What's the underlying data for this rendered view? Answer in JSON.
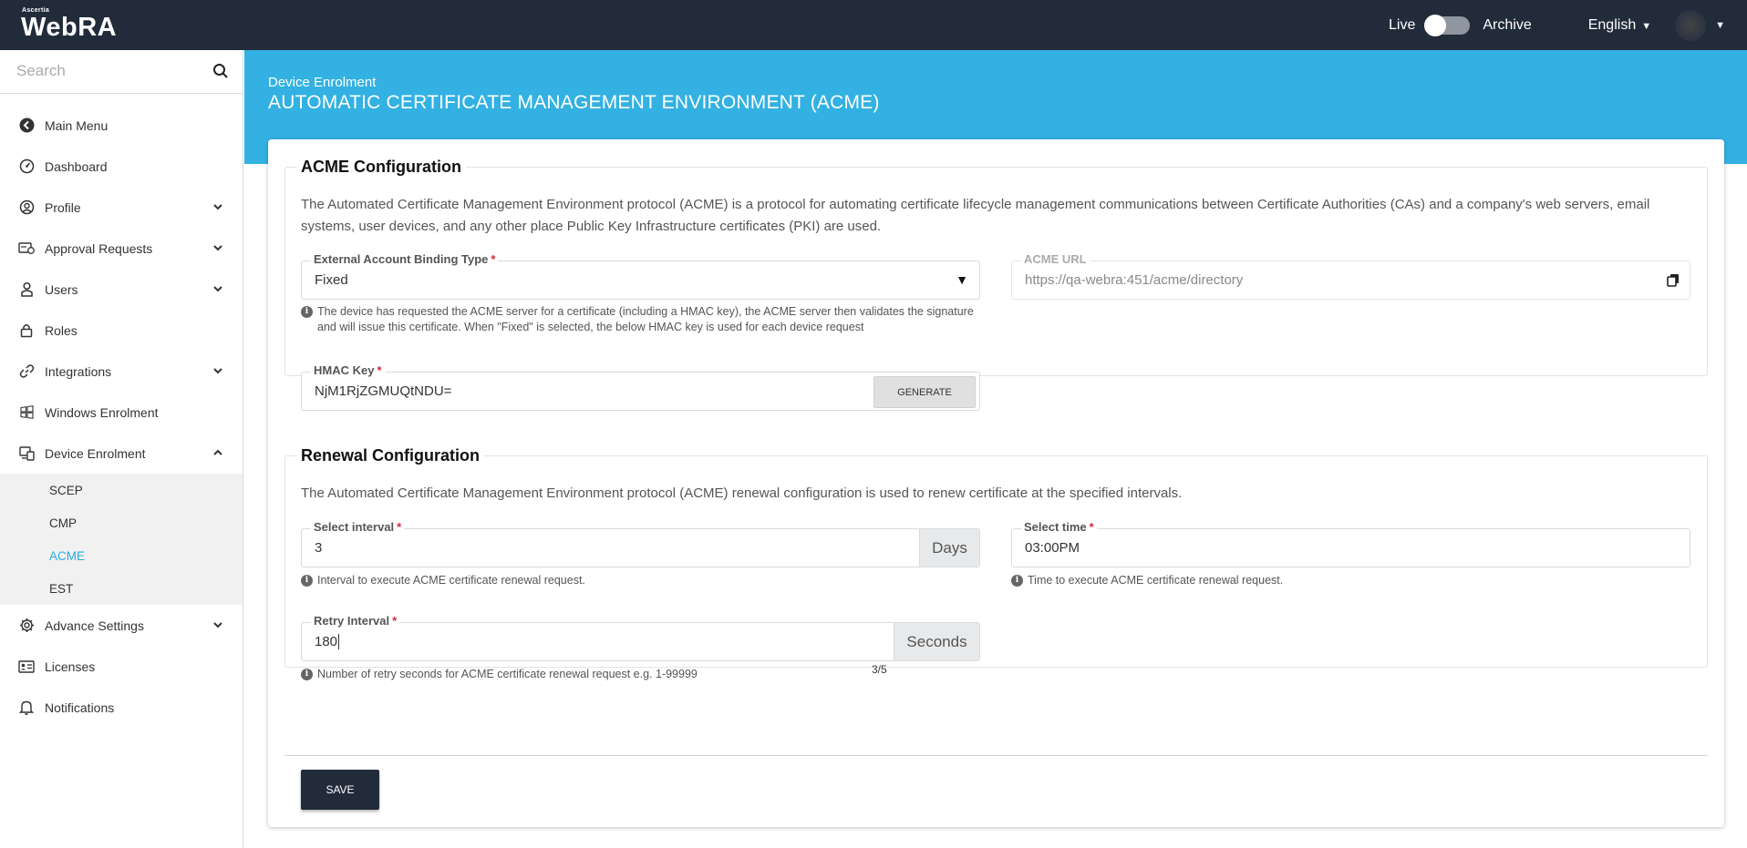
{
  "header": {
    "brand_small": "Ascertia",
    "brand_name": "WebRA",
    "live_label": "Live",
    "archive_label": "Archive",
    "language": "English"
  },
  "sidebar": {
    "search_placeholder": "Search",
    "items": [
      {
        "label": "Main Menu",
        "icon": "back-arrow-icon"
      },
      {
        "label": "Dashboard",
        "icon": "gauge-icon"
      },
      {
        "label": "Profile",
        "icon": "user-circle-icon"
      },
      {
        "label": "Approval Requests",
        "icon": "approval-card-icon"
      },
      {
        "label": "Users",
        "icon": "user-badge-icon"
      },
      {
        "label": "Roles",
        "icon": "lock-icon"
      },
      {
        "label": "Integrations",
        "icon": "link-icon"
      },
      {
        "label": "Windows Enrolment",
        "icon": "windows-icon"
      },
      {
        "label": "Device Enrolment",
        "icon": "device-icon"
      },
      {
        "label": "Advance Settings",
        "icon": "gear-icon"
      },
      {
        "label": "Licenses",
        "icon": "id-card-icon"
      },
      {
        "label": "Notifications",
        "icon": "bell-icon"
      }
    ],
    "sub_items": [
      "SCEP",
      "CMP",
      "ACME",
      "EST"
    ],
    "active_sub": "ACME"
  },
  "page": {
    "breadcrumb": "Device Enrolment",
    "title": "AUTOMATIC CERTIFICATE MANAGEMENT ENVIRONMENT (ACME)"
  },
  "acme": {
    "legend": "ACME Configuration",
    "description": "The Automated Certificate Management Environment protocol (ACME) is a protocol for automating certificate lifecycle management communications between Certificate Authorities (CAs) and a company's web servers, email systems, user devices, and any other place Public Key Infrastructure certificates (PKI) are used.",
    "binding_label": "External Account Binding Type",
    "binding_value": "Fixed",
    "binding_hint": "The device has requested the ACME server for a certificate (including a HMAC key), the ACME server then validates the signature and will issue this certificate. When \"Fixed\" is selected, the below HMAC key is used for each device request",
    "url_label": "ACME URL",
    "url_value": "https://qa-webra:451/acme/directory",
    "hmac_label": "HMAC Key",
    "hmac_value": "NjM1RjZGMUQtNDU=",
    "generate_label": "GENERATE"
  },
  "renewal": {
    "legend": "Renewal Configuration",
    "description": "The Automated Certificate Management Environment protocol (ACME) renewal configuration is used to renew certificate at the specified intervals.",
    "interval_label": "Select interval",
    "interval_value": "3",
    "interval_unit": "Days",
    "interval_hint": "Interval to execute ACME certificate renewal request.",
    "time_label": "Select time",
    "time_value": "03:00PM",
    "time_hint": "Time to execute ACME certificate renewal request.",
    "retry_label": "Retry Interval",
    "retry_value": "180",
    "retry_unit": "Seconds",
    "retry_hint": "Number of retry seconds for ACME certificate renewal request e.g. 1-99999",
    "retry_counter": "3/5"
  },
  "actions": {
    "save_label": "SAVE"
  },
  "colors": {
    "topbar": "#222b3a",
    "banner": "#32b1e2",
    "active": "#29abe2",
    "required": "#d9263a"
  }
}
